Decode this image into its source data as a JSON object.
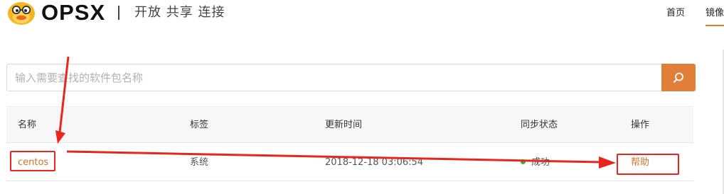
{
  "header": {
    "brand": "OPSX",
    "slogan": "开放 共享 连接",
    "nav": [
      {
        "label": "首页"
      },
      {
        "label": "镜像"
      }
    ],
    "active_nav": "镜像"
  },
  "search": {
    "placeholder": "输入需要查找的软件包名称",
    "value": "",
    "button_icon": "search-icon"
  },
  "table": {
    "columns": [
      "名称",
      "标签",
      "更新时间",
      "同步状态",
      "操作"
    ],
    "rows": [
      {
        "name": "centos",
        "tag": "系统",
        "updated": "2018-12-18 03:06:54",
        "status": "成功",
        "status_color": "#3cb034",
        "action": "帮助"
      }
    ]
  },
  "colors": {
    "accent": "#e07e3a",
    "annotation": "#e8261e"
  }
}
